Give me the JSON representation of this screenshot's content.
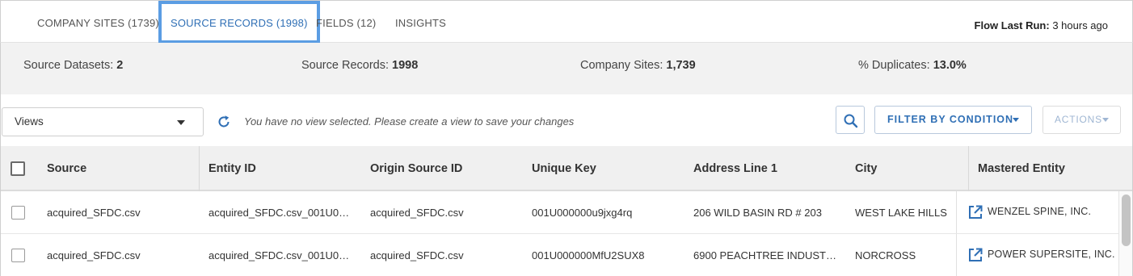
{
  "tabs": [
    {
      "label": "COMPANY SITES (1739)",
      "active": false
    },
    {
      "label": "SOURCE RECORDS (1998)",
      "active": true
    },
    {
      "label": "FIELDS (12)",
      "active": false
    },
    {
      "label": "INSIGHTS",
      "active": false
    }
  ],
  "flow_run": {
    "label": "Flow Last Run:",
    "value": "3 hours ago"
  },
  "stats": [
    {
      "label": "Source Datasets:",
      "value": "2"
    },
    {
      "label": "Source Records:",
      "value": "1998"
    },
    {
      "label": "Company Sites:",
      "value": "1,739"
    },
    {
      "label": "% Duplicates:",
      "value": "13.0%"
    }
  ],
  "toolbar": {
    "views_value": "Views",
    "hint": "You have no view selected. Please create a view to save your changes",
    "filter_label": "FILTER BY CONDITION",
    "actions_label": "ACTIONS",
    "search_icon": "search-icon",
    "refresh_icon": "refresh-icon"
  },
  "table": {
    "columns": [
      "Source",
      "Entity ID",
      "Origin Source ID",
      "Unique Key",
      "Address Line 1",
      "City",
      "Mastered Entity"
    ],
    "rows": [
      {
        "source": "acquired_SFDC.csv",
        "entity_id": "acquired_SFDC.csv_001U00…",
        "origin_source_id": "acquired_SFDC.csv",
        "unique_key": "001U000000u9jxg4rq",
        "address_line_1": "206 WILD BASIN RD # 203",
        "city": "WEST LAKE HILLS",
        "mastered_entity": "WENZEL SPINE, INC."
      },
      {
        "source": "acquired_SFDC.csv",
        "entity_id": "acquired_SFDC.csv_001U00…",
        "origin_source_id": "acquired_SFDC.csv",
        "unique_key": "001U000000MfU2SUX8",
        "address_line_1": "6900 PEACHTREE INDUSTRI…",
        "city": "NORCROSS",
        "mastered_entity": "POWER SUPERSITE, INC."
      }
    ]
  },
  "colors": {
    "accent": "#2f6fb5",
    "active_tab_border": "#5b9de3",
    "stats_bg": "#f2f2f2",
    "header_bg": "#f0f0f0"
  }
}
